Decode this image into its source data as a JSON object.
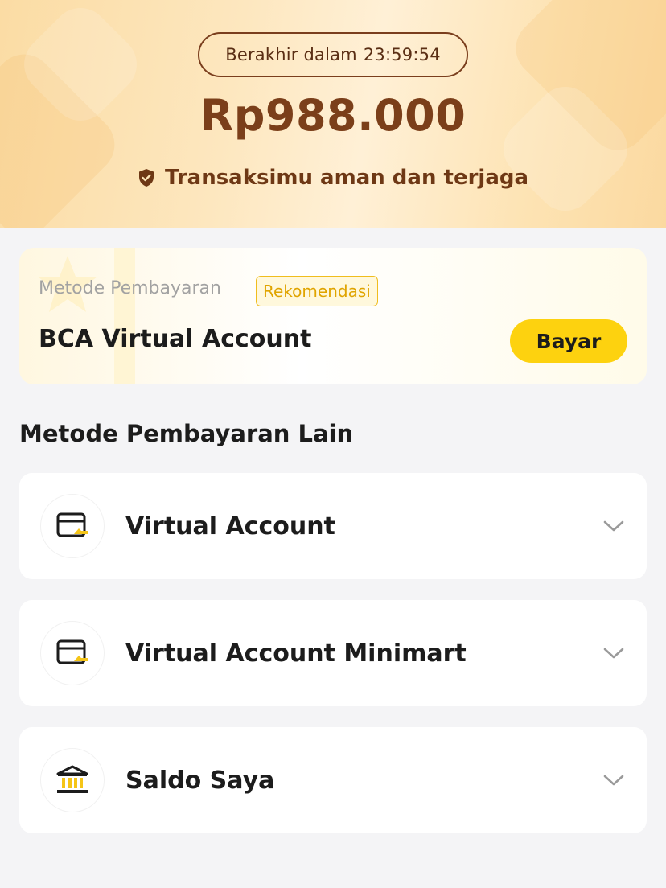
{
  "header": {
    "timer_label": "Berakhir dalam",
    "timer_value": "23:59:54",
    "amount": "Rp988.000",
    "secure_text": "Transaksimu aman dan terjaga"
  },
  "recommended": {
    "label": "Metode Pembayaran",
    "badge": "Rekomendasi",
    "method": "BCA Virtual Account",
    "pay_label": "Bayar"
  },
  "other_methods": {
    "title": "Metode Pembayaran Lain",
    "items": [
      {
        "name": "Virtual Account",
        "icon": "card-icon"
      },
      {
        "name": "Virtual Account Minimart",
        "icon": "card-icon"
      },
      {
        "name": "Saldo Saya",
        "icon": "bank-icon"
      }
    ]
  },
  "colors": {
    "accent_yellow": "#fdd20f",
    "brown_text": "#7b3f1a",
    "badge_border": "#f0bd1e"
  }
}
